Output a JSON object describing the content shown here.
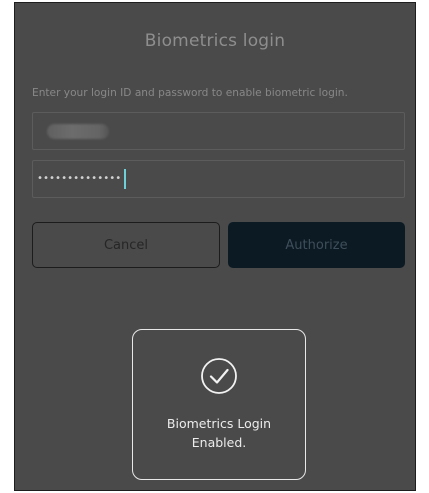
{
  "dialog": {
    "title": "Biometrics login",
    "instruction": "Enter your login ID and password to enable biometric login.",
    "password_value": "••••••••••••••",
    "cancel_label": "Cancel",
    "authorize_label": "Authorize"
  },
  "toast": {
    "icon": "checkmark-circle-icon",
    "line1": "Biometrics Login",
    "line2": "Enabled."
  },
  "colors": {
    "overlay": "#4a4a4a",
    "authorize_bg": "#0c1a24",
    "caret": "#6fd0d8",
    "toast_border": "#e8e8e8"
  }
}
